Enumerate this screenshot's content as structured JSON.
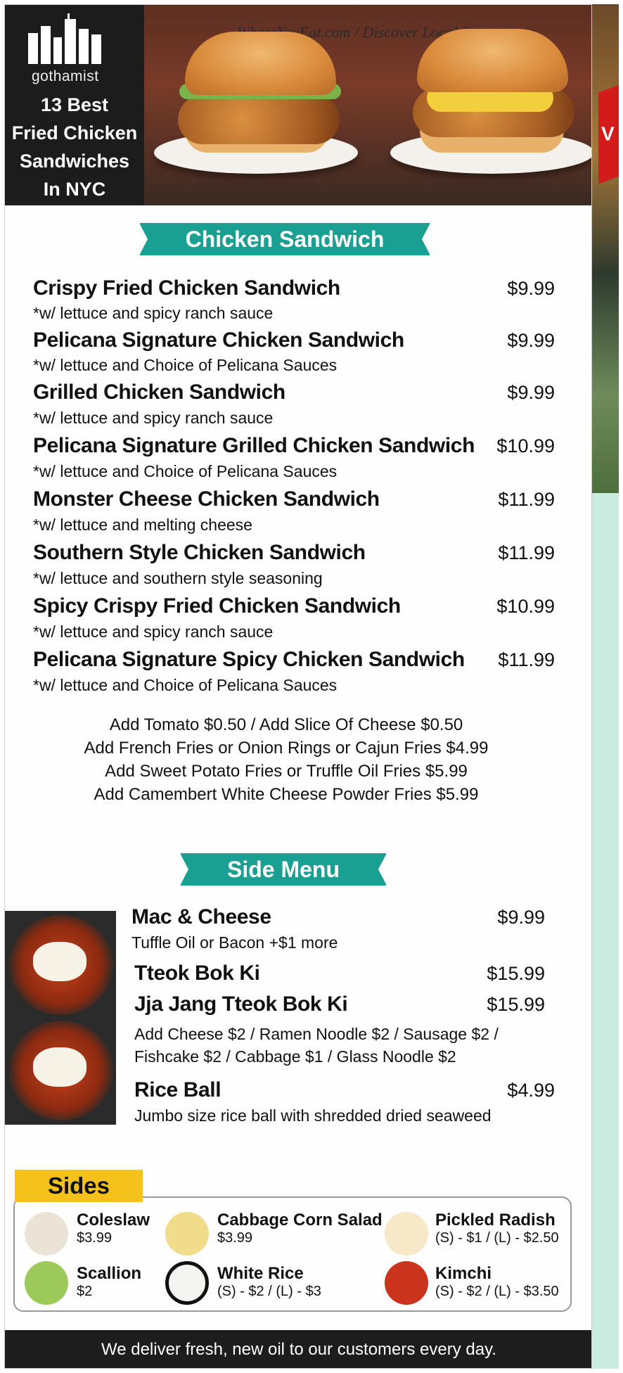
{
  "header": {
    "brand": "gothamist",
    "title": "13 Best\nFried Chicken\nSandwiches\nIn NYC",
    "watermark": "WhereYouEat.com / Discover Local Restaurants"
  },
  "right_strip_text": "V",
  "chicken_sandwich": {
    "heading": "Chicken Sandwich",
    "items": [
      {
        "name": "Crispy Fried Chicken Sandwich",
        "price": "$9.99",
        "desc": "*w/ lettuce and spicy ranch sauce"
      },
      {
        "name": "Pelicana Signature Chicken Sandwich",
        "price": "$9.99",
        "desc": "*w/ lettuce and Choice of Pelicana Sauces"
      },
      {
        "name": "Grilled Chicken Sandwich",
        "price": "$9.99",
        "desc": "*w/ lettuce and spicy ranch sauce"
      },
      {
        "name": "Pelicana Signature Grilled Chicken Sandwich",
        "price": "$10.99",
        "desc": "*w/ lettuce and Choice of Pelicana Sauces"
      },
      {
        "name": "Monster Cheese Chicken Sandwich",
        "price": "$11.99",
        "desc": "*w/ lettuce and melting cheese"
      },
      {
        "name": "Southern Style Chicken Sandwich",
        "price": "$11.99",
        "desc": "*w/ lettuce and southern style seasoning"
      },
      {
        "name": "Spicy Crispy Fried Chicken Sandwich",
        "price": "$10.99",
        "desc": "*w/ lettuce and spicy ranch sauce"
      },
      {
        "name": "Pelicana Signature Spicy Chicken Sandwich",
        "price": "$11.99",
        "desc": "*w/ lettuce and Choice of Pelicana Sauces"
      }
    ],
    "addons": [
      "Add Tomato $0.50 / Add Slice Of Cheese $0.50",
      "Add French Fries or Onion Rings or Cajun Fries $4.99",
      "Add Sweet Potato Fries or Truffle Oil Fries $5.99",
      "Add Camembert White Cheese Powder Fries $5.99"
    ]
  },
  "side_menu": {
    "heading": "Side Menu",
    "items": [
      {
        "name": "Mac & Cheese",
        "price": "$9.99",
        "desc": "Tuffle Oil or Bacon +$1 more"
      },
      {
        "name": "Tteok Bok Ki",
        "price": "$15.99",
        "desc": ""
      },
      {
        "name": "Jja Jang Tteok Bok Ki",
        "price": "$15.99",
        "desc": "Add Cheese $2 / Ramen Noodle $2 / Sausage $2 /"
      },
      {
        "name": "Rice Ball",
        "price": "$4.99",
        "desc": "Jumbo size rice ball with shredded dried seaweed"
      }
    ],
    "extra_desc": "Fishcake $2 / Cabbage $1 / Glass Noodle $2"
  },
  "sides": {
    "heading": "Sides",
    "items": [
      {
        "name": "Coleslaw",
        "price": "$3.99",
        "icon": "coleslaw-icon",
        "color": "#e9e4d6"
      },
      {
        "name": "Cabbage Corn Salad",
        "price": "$3.99",
        "icon": "corn-salad-icon",
        "color": "#f0dc8a"
      },
      {
        "name": "Pickled Radish",
        "price": "(S) - $1 / (L) - $2.50",
        "icon": "radish-icon",
        "color": "#f7e9c8"
      },
      {
        "name": "Scallion",
        "price": "$2",
        "icon": "scallion-icon",
        "color": "#9bc95a"
      },
      {
        "name": "White Rice",
        "price": "(S) - $2 / (L) - $3",
        "icon": "rice-icon",
        "color": "#f4f4f0"
      },
      {
        "name": "Kimchi",
        "price": "(S) - $2 / (L) - $3.50",
        "icon": "kimchi-icon",
        "color": "#c9341c"
      }
    ]
  },
  "footer": "We deliver fresh, new oil to our customers every day.",
  "colors": {
    "teal": "#1aa093",
    "yellow": "#f4c21b",
    "dark": "#1d1d1d"
  }
}
